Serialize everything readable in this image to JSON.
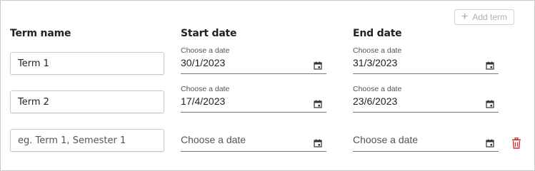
{
  "toolbar": {
    "add_term_label": "Add term",
    "add_icon": "plus-icon"
  },
  "columns": {
    "term_name": "Term name",
    "start_date": "Start date",
    "end_date": "End date"
  },
  "date_label": "Choose a date",
  "rows": [
    {
      "term_value": "Term 1",
      "term_placeholder": "",
      "start": "30/1/2023",
      "end": "31/3/2023"
    },
    {
      "term_value": "Term 2",
      "term_placeholder": "",
      "start": "17/4/2023",
      "end": "23/6/2023"
    },
    {
      "term_value": "",
      "term_placeholder": "eg. Term 1, Semester 1",
      "start_placeholder": "Choose a date",
      "end_placeholder": "Choose a date"
    }
  ],
  "icons": {
    "calendar": "calendar-icon",
    "delete": "trash-icon"
  },
  "colors": {
    "delete": "#d32f2f",
    "disabled": "#b0b0b0"
  }
}
